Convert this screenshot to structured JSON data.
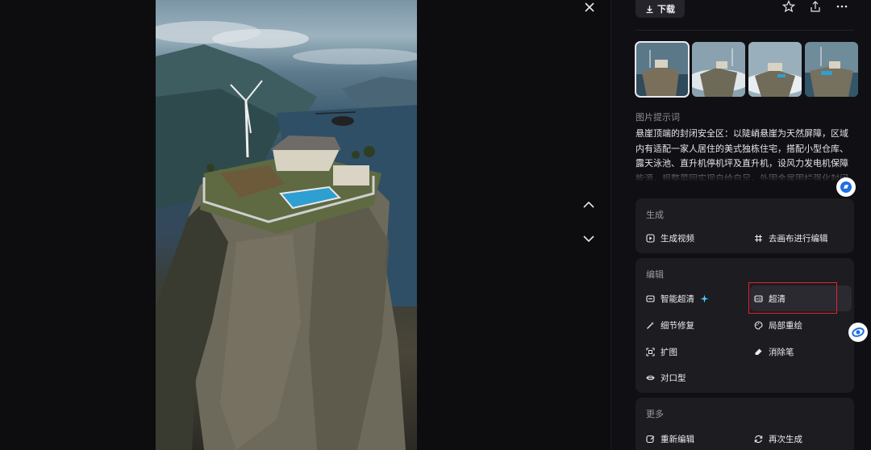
{
  "toolbar": {
    "download_label": "下载"
  },
  "prompt": {
    "label": "图片提示词",
    "text": "悬崖顶端的封闭安全区：以陡峭悬崖为天然屏障，区域内有适配一家人居住的美式独栋住宅，搭配小型仓库、露天泳池、直升机停机坪及直升机，设风力发电机保障能源，规整菜园实现自给自足，外围金属围栏强化封闭感，远方衬以云雾缭绕的山峦，整体风格写实且细节丰富。"
  },
  "sections": {
    "generate": {
      "title": "生成",
      "items": [
        "生成视频",
        "去画布进行编辑"
      ]
    },
    "edit": {
      "title": "编辑",
      "items": [
        "智能超清",
        "超清",
        "细节修复",
        "局部重绘",
        "扩图",
        "消除笔",
        "对口型"
      ]
    },
    "more": {
      "title": "更多",
      "items": [
        "重新编辑",
        "再次生成"
      ]
    }
  },
  "colors": {
    "accent_highlight": "#e0242b",
    "sparkle": "#4dd3ff",
    "panel_bg": "#101014",
    "card_bg": "#1c1c21"
  },
  "icons": [
    "close-icon",
    "chevron-up-icon",
    "chevron-down-icon",
    "download-icon",
    "star-icon",
    "share-icon",
    "more-icon"
  ]
}
